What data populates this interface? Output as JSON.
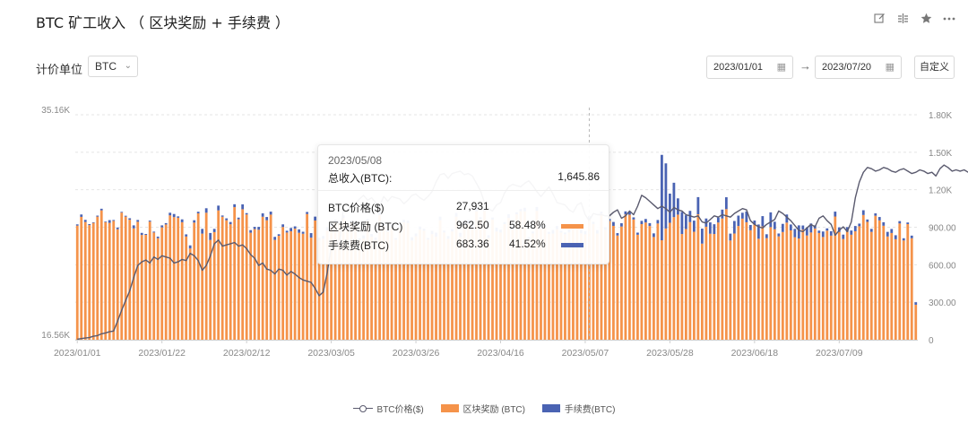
{
  "header": {
    "title": "BTC 矿工收入 （ 区块奖励 + 手续费 ）",
    "tools": [
      "edit-icon",
      "compare-icon",
      "star-icon",
      "more-icon"
    ]
  },
  "controls": {
    "unit_label": "计价单位",
    "unit_value": "BTC",
    "start_date": "2023/01/01",
    "end_date": "2023/07/20",
    "custom_label": "自定义"
  },
  "tooltip": {
    "date": "2023/05/08",
    "total_label": "总收入(BTC):",
    "total_value": "1,645.86",
    "rows": [
      {
        "name": "BTC价格($)",
        "value": "27,931",
        "pct": ""
      },
      {
        "name": "区块奖励 (BTC)",
        "value": "962.50",
        "pct": "58.48%"
      },
      {
        "name": "手续费(BTC)",
        "value": "683.36",
        "pct": "41.52%"
      }
    ]
  },
  "colors": {
    "reward": "#f5934a",
    "fee": "#4a63b3",
    "price": "#5a5a6e",
    "grid": "#e5e5e5",
    "axis_text": "#888888"
  },
  "chart_data": {
    "type": "bar",
    "stacked": true,
    "x_ticks": [
      "2023/01/01",
      "2023/01/22",
      "2023/02/12",
      "2023/03/05",
      "2023/03/26",
      "2023/04/16",
      "2023/05/07",
      "2023/05/28",
      "2023/06/18",
      "2023/07/09"
    ],
    "left_axis": {
      "ticks": [
        "35.16K",
        "16.56K"
      ],
      "range": [
        16560,
        35160
      ]
    },
    "right_axis": {
      "ticks": [
        "1.80K",
        "1.50K",
        "1.20K",
        "900.00",
        "600.00",
        "300.00",
        "0"
      ],
      "range": [
        0,
        1800
      ]
    },
    "reward_values": [
      913,
      983,
      942,
      917,
      935,
      985,
      1035,
      941,
      935,
      951,
      884,
      1017,
      985,
      960,
      891,
      944,
      838,
      839,
      945,
      858,
      812,
      899,
      922,
      995,
      981,
      976,
      940,
      826,
      730,
      937,
      1011,
      849,
      1016,
      798,
      861,
      1035,
      984,
      956,
      924,
      1061,
      964,
      1044,
      1002,
      856,
      885,
      880,
      984,
      956,
      1001,
      799,
      832,
      902,
      858,
      868,
      889,
      856,
      848,
      1006,
      817,
      954,
      795,
      808,
      873,
      906,
      942,
      932,
      974,
      881,
      941,
      920,
      798,
      809,
      949,
      824,
      799,
      997,
      912,
      864,
      897,
      801,
      897,
      939,
      934,
      794,
      828,
      881,
      872,
      801,
      845,
      825,
      956,
      858,
      807,
      866,
      985,
      822,
      919,
      927,
      893,
      1027,
      962,
      1029,
      814,
      961,
      866,
      858,
      925,
      974,
      883,
      1003,
      1028,
      1027,
      805,
      850,
      1031,
      888,
      896,
      847,
      849,
      883,
      857,
      844,
      858,
      899,
      907,
      851,
      843,
      962,
      926,
      849,
      1008,
      880,
      950,
      911,
      834,
      906,
      1002,
      1000,
      962,
      840,
      925,
      938,
      910,
      822,
      930,
      796,
      890,
      936,
      981,
      1001,
      846,
      886,
      941,
      864,
      1004,
      769,
      904,
      848,
      846,
      938,
      970,
      1045,
      794,
      850,
      910,
      969,
      940,
      876,
      920,
      808,
      907,
      813,
      901,
      884,
      827,
      862,
      937,
      875,
      820,
      810,
      881,
      834,
      858,
      890,
      854,
      822,
      873,
      833,
      986,
      862,
      806,
      864,
      840,
      868,
      908,
      998,
      943,
      863,
      992,
      955,
      912,
      826,
      854,
      804,
      930,
      794,
      925,
      812,
      280
    ],
    "fee_values": [
      10,
      19,
      17,
      8,
      5,
      8,
      13,
      5,
      22,
      7,
      14,
      6,
      7,
      12,
      24,
      14,
      17,
      7,
      8,
      7,
      13,
      16,
      11,
      21,
      25,
      11,
      23,
      17,
      25,
      19,
      13,
      38,
      36,
      56,
      26,
      38,
      10,
      15,
      18,
      23,
      13,
      39,
      11,
      21,
      18,
      23,
      27,
      26,
      24,
      24,
      12,
      21,
      14,
      26,
      18,
      27,
      16,
      16,
      36,
      31,
      21,
      22,
      28,
      23,
      19,
      17,
      22,
      25,
      13,
      21,
      14,
      25,
      16,
      22,
      18,
      36,
      13,
      16,
      26,
      12,
      21,
      21,
      18,
      26,
      22,
      25,
      16,
      13,
      26,
      32,
      29,
      15,
      22,
      19,
      30,
      33,
      29,
      32,
      27,
      29,
      19,
      18,
      22,
      17,
      30,
      22,
      16,
      30,
      25,
      17,
      17,
      29,
      17,
      16,
      31,
      27,
      21,
      16,
      29,
      27,
      14,
      14,
      24,
      20,
      15,
      29,
      26,
      27,
      17,
      28,
      17,
      21,
      17,
      31,
      19,
      26,
      25,
      24,
      17,
      17,
      26,
      28,
      23,
      29,
      28,
      683,
      521,
      233,
      275,
      130,
      176,
      110,
      90,
      89,
      137,
      120,
      66,
      91,
      78,
      40,
      71,
      95,
      55,
      100,
      83,
      47,
      86,
      42,
      34,
      114,
      82,
      31,
      118,
      60,
      23,
      65,
      65,
      47,
      67,
      105,
      33,
      65,
      72,
      25,
      19,
      44,
      18,
      35,
      39,
      37,
      35,
      37,
      34,
      42,
      21,
      38,
      19,
      24,
      19,
      27,
      28,
      37,
      32,
      32,
      19,
      18,
      13,
      21,
      20,
      16,
      11,
      10,
      24,
      34,
      25,
      18,
      19,
      19,
      24,
      20,
      10
    ],
    "price_values": [
      16600,
      16660,
      16700,
      16740,
      16850,
      16900,
      17050,
      17120,
      17220,
      17280,
      18100,
      19000,
      19800,
      20600,
      21700,
      22700,
      23000,
      23150,
      22900,
      23400,
      23200,
      23500,
      23400,
      23300,
      22900,
      23000,
      23200,
      23100,
      23700,
      23500,
      23100,
      22300,
      22700,
      23500,
      24500,
      24800,
      24300,
      24400,
      24500,
      24600,
      24300,
      24400,
      24100,
      23600,
      23300,
      22700,
      22900,
      22400,
      22300,
      22000,
      22400,
      22300,
      21900,
      22200,
      22000,
      21700,
      21500,
      21400,
      21300,
      20800,
      20200,
      20500,
      22100,
      24300,
      24800,
      24500,
      27400,
      27200,
      27600,
      27800,
      28200,
      28500,
      28100,
      28300,
      27900,
      27600,
      28400,
      28000,
      28400,
      28300,
      28200,
      27800,
      28100,
      28500,
      28600,
      28300,
      28100,
      28400,
      28800,
      29600,
      30200,
      30300,
      29900,
      30300,
      30400,
      30500,
      30200,
      30300,
      30100,
      29500,
      28900,
      27900,
      27400,
      27200,
      27700,
      27900,
      28700,
      29200,
      29400,
      29300,
      29200,
      29500,
      29700,
      29300,
      28800,
      28400,
      28800,
      29200,
      28600,
      27900,
      27800,
      27700,
      27300,
      27100,
      27700,
      27900,
      26900,
      26400,
      27000,
      26900,
      26900,
      26800,
      26800,
      27100,
      27300,
      26600,
      26800,
      27200,
      26900,
      27600,
      28500,
      28300,
      28000,
      27700,
      27400,
      27600,
      27400,
      27100,
      27500,
      27300,
      27200,
      26900,
      26800,
      26700,
      26800,
      26300,
      26200,
      26500,
      26800,
      26700,
      26900,
      26800,
      26700,
      27000,
      27200,
      27400,
      27300,
      26400,
      26100,
      25900,
      25800,
      26100,
      26300,
      26500,
      27200,
      27000,
      26700,
      26400,
      26000,
      25600,
      25500,
      25800,
      26100,
      25900,
      26600,
      26800,
      26400,
      26100,
      25200,
      25600,
      25900,
      25500,
      26300,
      28300,
      29600,
      30400,
      30800,
      30700,
      30500,
      30600,
      30800,
      30700,
      30500,
      30400,
      30600,
      30700,
      30500,
      30300,
      30400,
      30600,
      30500,
      30300,
      30400,
      30100,
      30700,
      31000,
      30800,
      30500,
      30600,
      30500,
      30600,
      30400,
      30700,
      30600,
      30500,
      30300,
      30400,
      30300,
      30500,
      30400,
      30300,
      30600,
      30800,
      30900,
      30500,
      30700,
      31100,
      30800,
      31400,
      30300,
      30400,
      30200,
      30100,
      30000,
      30100,
      29900
    ]
  },
  "legend": [
    {
      "label": "BTC价格($)",
      "kind": "line",
      "color": "#5a5a6e"
    },
    {
      "label": "区块奖励 (BTC)",
      "kind": "bar",
      "color": "#f5934a"
    },
    {
      "label": "手续费(BTC)",
      "kind": "bar",
      "color": "#4a63b3"
    }
  ]
}
